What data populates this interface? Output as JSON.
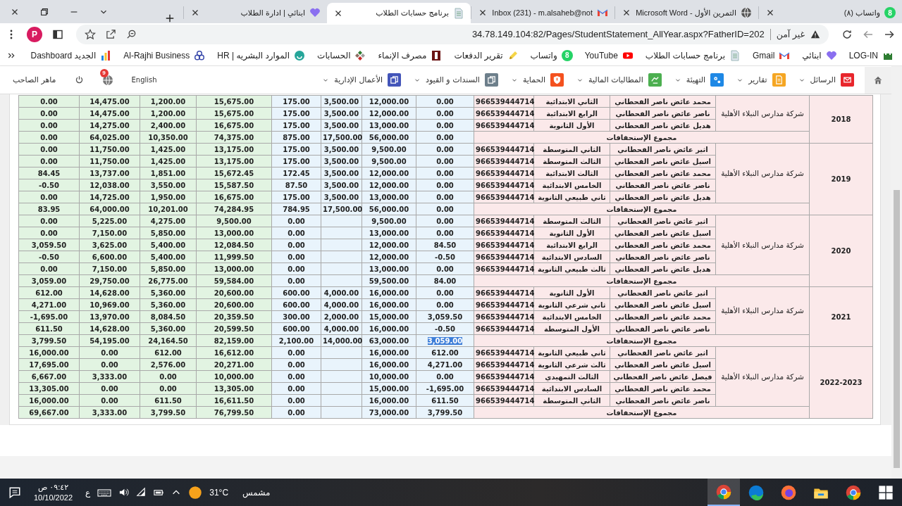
{
  "tabs": [
    {
      "title": "واتساب (٨)",
      "kind": "whatsapp",
      "icon_count": "8",
      "selected": false
    },
    {
      "title": "التمرين الأول - Microsoft Word",
      "kind": "globe",
      "selected": false
    },
    {
      "title": "Inbox (231) - m.alsaheb@not",
      "kind": "gmail",
      "selected": false
    },
    {
      "title": "برنامج حسابات الطلاب",
      "kind": "doc",
      "selected": true
    },
    {
      "title": "ابنائي | ادارة الطلاب",
      "kind": "heart",
      "selected": false
    }
  ],
  "address_bar": {
    "security": "غير آمن",
    "url": "34.78.149.104:82/Pages/StudentStatement_AllYear.aspx?FatherID=202"
  },
  "profile": {
    "initial": "P"
  },
  "bookmarks": [
    {
      "label": "LOG-IN",
      "kind": "login"
    },
    {
      "label": "ابنائي",
      "kind": "heart"
    },
    {
      "label": "Gmail",
      "kind": "gmail"
    },
    {
      "label": "برنامج حسابات الطلاب",
      "kind": "doc"
    },
    {
      "label": "YouTube",
      "kind": "youtube"
    },
    {
      "label": "واتساب",
      "kind": "whatsapp",
      "icon_count": "8"
    },
    {
      "label": "تقرير الدفعات",
      "kind": "pen"
    },
    {
      "label": "مصرف الإنماء",
      "kind": "bank"
    },
    {
      "label": "الحسابات",
      "kind": "diamond"
    },
    {
      "label": "الموارد البشريه | HR",
      "kind": "hr"
    },
    {
      "label": "Al-Rajhi Business",
      "kind": "rings"
    },
    {
      "label": "Dashboard الجديد",
      "kind": "chart"
    }
  ],
  "nav": {
    "menus": [
      {
        "label": "الرسائل",
        "kind": "mail",
        "color": "#e8262c"
      },
      {
        "label": "تقارير",
        "kind": "report",
        "color": "#f5a623"
      },
      {
        "label": "التهيئة",
        "kind": "gears",
        "color": "#1e88e5"
      },
      {
        "label": "المطالبات المالية",
        "kind": "money",
        "color": "#4caf50"
      },
      {
        "label": "الحماية",
        "kind": "shield",
        "color": "#f4511e"
      },
      {
        "label": "السندات و القيود",
        "kind": "copy",
        "color": "#6d7f8b"
      },
      {
        "label": "الأعمال الإدارية",
        "kind": "copy",
        "color": "#4355b9"
      }
    ],
    "user": {
      "language": "English",
      "notifications": "9",
      "name": "ماهر الصاحب"
    }
  },
  "statement": {
    "sections": [
      {
        "year": "2018",
        "company": "شركة مدارس النبلاء الأهلية",
        "students": [
          {
            "name": "محمد عائض ناصر القحطاني",
            "grade": "الثاني الابتدائية",
            "phone": "966539444714",
            "amounts": {
              "column_1": "0.00",
              "column_2": "14,475.00",
              "column_3": "1,200.00",
              "column_4": "15,675.00",
              "column_5": "175.00",
              "column_6": "3,500.00",
              "column_7": "12,000.00",
              "column_8": "0.00"
            }
          },
          {
            "name": "ناصر عائض ناصر القحطاني",
            "grade": "الرابع الابتدائية",
            "phone": "966539444714",
            "amounts": {
              "column_1": "0.00",
              "column_2": "14,475.00",
              "column_3": "1,200.00",
              "column_4": "15,675.00",
              "column_5": "175.00",
              "column_6": "3,500.00",
              "column_7": "12,000.00",
              "column_8": "0.00"
            }
          },
          {
            "name": "هديل عائض ناصر القحطاني",
            "grade": "الأول الثانوية",
            "phone": "966539444714",
            "amounts": {
              "column_1": "0.00",
              "column_2": "14,275.00",
              "column_3": "2,400.00",
              "column_4": "16,675.00",
              "column_5": "175.00",
              "column_6": "3,500.00",
              "column_7": "13,000.00",
              "column_8": "0.00"
            }
          }
        ],
        "total": {
          "label": "مجموع الإستحقاقات",
          "amounts": {
            "column_1": "0.00",
            "column_2": "64,025.00",
            "column_3": "10,350.00",
            "column_4": "74,375.00",
            "column_5": "875.00",
            "column_6": "17,500.00",
            "column_7": "56,000.00",
            "column_8": "0.00"
          },
          "text_selected": false
        }
      },
      {
        "year": "2019",
        "company": "شركة مدارس النبلاء الأهلية",
        "students": [
          {
            "name": "اثير عائض ناصر القحطاني",
            "grade": "الثاني المتوسطة",
            "phone": "966539444714",
            "amounts": {
              "column_1": "0.00",
              "column_2": "11,750.00",
              "column_3": "1,425.00",
              "column_4": "13,175.00",
              "column_5": "175.00",
              "column_6": "3,500.00",
              "column_7": "9,500.00",
              "column_8": "0.00"
            }
          },
          {
            "name": "اسيل عائض ناصر القحطاني",
            "grade": "الثالث المتوسطة",
            "phone": "966539444714",
            "amounts": {
              "column_1": "0.00",
              "column_2": "11,750.00",
              "column_3": "1,425.00",
              "column_4": "13,175.00",
              "column_5": "175.00",
              "column_6": "3,500.00",
              "column_7": "9,500.00",
              "column_8": "0.00"
            }
          },
          {
            "name": "محمد عائض ناصر القحطاني",
            "grade": "الثالث الابتدائية",
            "phone": "966539444714",
            "amounts": {
              "column_1": "84.45",
              "column_2": "13,737.00",
              "column_3": "1,851.00",
              "column_4": "15,672.45",
              "column_5": "172.45",
              "column_6": "3,500.00",
              "column_7": "12,000.00",
              "column_8": "0.00"
            }
          },
          {
            "name": "ناصر عائض ناصر القحطاني",
            "grade": "الخامس الابتدائية",
            "phone": "966539444714",
            "amounts": {
              "column_1": "-0.50",
              "column_2": "12,038.00",
              "column_3": "3,550.00",
              "column_4": "15,587.50",
              "column_5": "87.50",
              "column_6": "3,500.00",
              "column_7": "12,000.00",
              "column_8": "0.00"
            }
          },
          {
            "name": "هديل عائض ناصر القحطاني",
            "grade": "ثاني طبيعي الثانوية",
            "phone": "966539444714",
            "amounts": {
              "column_1": "0.00",
              "column_2": "14,725.00",
              "column_3": "1,950.00",
              "column_4": "16,675.00",
              "column_5": "175.00",
              "column_6": "3,500.00",
              "column_7": "13,000.00",
              "column_8": "0.00"
            }
          }
        ],
        "total": {
          "label": "مجموع الإستحقاقات",
          "amounts": {
            "column_1": "83.95",
            "column_2": "64,000.00",
            "column_3": "10,201.00",
            "column_4": "74,284.95",
            "column_5": "784.95",
            "column_6": "17,500.00",
            "column_7": "56,000.00",
            "column_8": "0.00"
          },
          "text_selected": false
        }
      },
      {
        "year": "2020",
        "company": "شركة مدارس النبلاء الأهلية",
        "students": [
          {
            "name": "اثير عائض ناصر القحطاني",
            "grade": "الثالث المتوسطة",
            "phone": "966539444714",
            "amounts": {
              "column_1": "0.00",
              "column_2": "5,225.00",
              "column_3": "4,275.00",
              "column_4": "9,500.00",
              "column_5": "0.00",
              "column_7": "9,500.00",
              "column_8": "0.00"
            }
          },
          {
            "name": "اسيل عائض ناصر القحطاني",
            "grade": "الأول الثانوية",
            "phone": "966539444714",
            "amounts": {
              "column_1": "0.00",
              "column_2": "7,150.00",
              "column_3": "5,850.00",
              "column_4": "13,000.00",
              "column_5": "0.00",
              "column_7": "13,000.00",
              "column_8": "0.00"
            }
          },
          {
            "name": "محمد عائض ناصر القحطاني",
            "grade": "الرابع الابتدائية",
            "phone": "966539444714",
            "amounts": {
              "column_1": "3,059.50",
              "column_2": "3,625.00",
              "column_3": "5,400.00",
              "column_4": "12,084.50",
              "column_5": "0.00",
              "column_7": "12,000.00",
              "column_8": "84.50"
            }
          },
          {
            "name": "ناصر عائض ناصر القحطاني",
            "grade": "السادس الابتدائية",
            "phone": "966539444714",
            "amounts": {
              "column_1": "-0.50",
              "column_2": "6,600.00",
              "column_3": "5,400.00",
              "column_4": "11,999.50",
              "column_5": "0.00",
              "column_7": "12,000.00",
              "column_8": "-0.50"
            }
          },
          {
            "name": "هديل عائض ناصر القحطاني",
            "grade": "ثالث طبيعي الثانوية",
            "phone": "966539444714",
            "amounts": {
              "column_1": "0.00",
              "column_2": "7,150.00",
              "column_3": "5,850.00",
              "column_4": "13,000.00",
              "column_5": "0.00",
              "column_7": "13,000.00",
              "column_8": "0.00"
            }
          }
        ],
        "total": {
          "label": "مجموع الإستحقاقات",
          "amounts": {
            "column_1": "3,059.00",
            "column_2": "29,750.00",
            "column_3": "26,775.00",
            "column_4": "59,584.00",
            "column_5": "0.00",
            "column_7": "59,500.00",
            "column_8": "84.00"
          },
          "text_selected": false
        }
      },
      {
        "year": "2021",
        "company": "شركة مدارس النبلاء الأهلية",
        "students": [
          {
            "name": "اثير عائض ناصر القحطاني",
            "grade": "الأول الثانوية",
            "phone": "966539444714",
            "amounts": {
              "column_1": "612.00",
              "column_2": "14,628.00",
              "column_3": "5,360.00",
              "column_4": "20,600.00",
              "column_5": "600.00",
              "column_6": "4,000.00",
              "column_7": "16,000.00",
              "column_8": "0.00"
            }
          },
          {
            "name": "اسيل عائض ناصر القحطاني",
            "grade": "ثاني شرعي الثانوية",
            "phone": "966539444714",
            "amounts": {
              "column_1": "4,271.00",
              "column_2": "10,969.00",
              "column_3": "5,360.00",
              "column_4": "20,600.00",
              "column_5": "600.00",
              "column_6": "4,000.00",
              "column_7": "16,000.00",
              "column_8": "0.00"
            }
          },
          {
            "name": "محمد عائض ناصر القحطاني",
            "grade": "الخامس الابتدائية",
            "phone": "966539444714",
            "amounts": {
              "column_1": "-1,695.00",
              "column_2": "13,970.00",
              "column_3": "8,084.50",
              "column_4": "20,359.50",
              "column_5": "300.00",
              "column_6": "2,000.00",
              "column_7": "15,000.00",
              "column_8": "3,059.50"
            }
          },
          {
            "name": "ناصر عائض ناصر القحطاني",
            "grade": "الأول المتوسطة",
            "phone": "966539444714",
            "amounts": {
              "column_1": "611.50",
              "column_2": "14,628.00",
              "column_3": "5,360.00",
              "column_4": "20,599.50",
              "column_5": "600.00",
              "column_6": "4,000.00",
              "column_7": "16,000.00",
              "column_8": "-0.50"
            }
          }
        ],
        "total": {
          "label": "مجموع الإستحقاقات",
          "amounts": {
            "column_1": "3,799.50",
            "column_2": "54,195.00",
            "column_3": "24,164.50",
            "column_4": "82,159.00",
            "column_5": "2,100.00",
            "column_6": "14,000.00",
            "column_7": "63,000.00",
            "column_8": "3,059.00"
          },
          "text_selected": true
        }
      },
      {
        "year": "2022-2023",
        "company": "شركة مدارس النبلاء الأهلية",
        "students": [
          {
            "name": "اثير عائض ناصر القحطاني",
            "grade": "ثاني طبيعي الثانوية",
            "phone": "966539444714",
            "amounts": {
              "column_1": "16,000.00",
              "column_2": "0.00",
              "column_3": "612.00",
              "column_4": "16,612.00",
              "column_5": "0.00",
              "column_7": "16,000.00",
              "column_8": "612.00"
            }
          },
          {
            "name": "اسيل عائض ناصر القحطاني",
            "grade": "ثالث شرعي الثانوية",
            "phone": "966539444714",
            "amounts": {
              "column_1": "17,695.00",
              "column_2": "0.00",
              "column_3": "2,576.00",
              "column_4": "20,271.00",
              "column_5": "0.00",
              "column_7": "16,000.00",
              "column_8": "4,271.00"
            }
          },
          {
            "name": "فيصل عائض ناصر القحطاني",
            "grade": "الثالث التمهيدي",
            "phone": "966539444714",
            "amounts": {
              "column_1": "6,667.00",
              "column_2": "3,333.00",
              "column_3": "0.00",
              "column_4": "10,000.00",
              "column_5": "0.00",
              "column_7": "10,000.00",
              "column_8": "0.00"
            }
          },
          {
            "name": "محمد عائض ناصر القحطاني",
            "grade": "السادس الابتدائية",
            "phone": "966539444714",
            "amounts": {
              "column_1": "13,305.00",
              "column_2": "0.00",
              "column_3": "0.00",
              "column_4": "13,305.00",
              "column_5": "0.00",
              "column_7": "15,000.00",
              "column_8": "-1,695.00"
            }
          },
          {
            "name": "ناصر عائض ناصر القحطاني",
            "grade": "الثاني المتوسطة",
            "phone": "966539444714",
            "amounts": {
              "column_1": "16,000.00",
              "column_2": "0.00",
              "column_3": "611.50",
              "column_4": "16,611.50",
              "column_5": "0.00",
              "column_7": "16,000.00",
              "column_8": "611.50"
            }
          }
        ],
        "total": {
          "label": "مجموع الإستحقاقات",
          "amounts": {
            "column_1": "69,667.00",
            "column_2": "3,333.00",
            "column_3": "3,799.50",
            "column_4": "76,799.50",
            "column_5": "0.00",
            "column_7": "73,000.00",
            "column_8": "3,799.50"
          },
          "text_selected": false
        }
      }
    ]
  },
  "taskbar": {
    "apps": [
      {
        "kind": "windows",
        "active": false
      },
      {
        "kind": "chrome",
        "active": false
      },
      {
        "kind": "explorer",
        "active": false
      },
      {
        "kind": "firefox",
        "active": false
      },
      {
        "kind": "edge",
        "active": false
      },
      {
        "kind": "chrome",
        "active": true
      }
    ],
    "weather": {
      "condition": "مشمس",
      "temperature": "31°C"
    },
    "input_language": "ع",
    "time": "٠٩:٤٢ ص",
    "date": "10/10/2022"
  }
}
